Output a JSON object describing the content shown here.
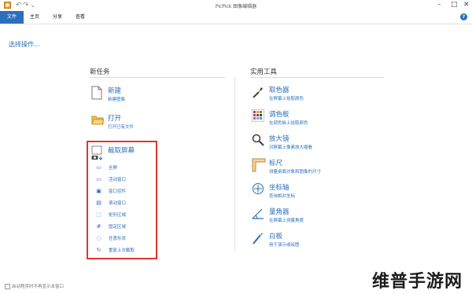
{
  "app": {
    "title": "PicPick 图像编辑器"
  },
  "menu": {
    "items": [
      "文件",
      "主页",
      "分享",
      "查看"
    ],
    "active": 0,
    "help": "?"
  },
  "window_controls": {
    "minimize": "–",
    "maximize": "□",
    "close": "✕"
  },
  "select_action": "选择操作...",
  "new_task": {
    "title": "新任务",
    "new": {
      "label": "新建",
      "sub": "新建图像"
    },
    "open": {
      "label": "打开",
      "sub": "打开已有文件"
    },
    "capture": {
      "label": "截取屏幕",
      "items": [
        "全屏",
        "活动窗口",
        "窗口控件",
        "滚动窗口",
        "矩形区域",
        "固定区域",
        "任意形状",
        "重复上次截取"
      ]
    }
  },
  "tools": {
    "title": "实用工具",
    "items": [
      {
        "label": "取色器",
        "sub": "在屏幕上拾取颜色"
      },
      {
        "label": "调色板",
        "sub": "在调色板上拾取颜色"
      },
      {
        "label": "放大镜",
        "sub": "对屏幕上像素放大缩看"
      },
      {
        "label": "标尺",
        "sub": "测量桌面对象和图像的尺寸"
      },
      {
        "label": "坐标轴",
        "sub": "查询相对坐标"
      },
      {
        "label": "量角器",
        "sub": "在屏幕上测量角度"
      },
      {
        "label": "白板",
        "sub": "用于演示或绘图"
      }
    ]
  },
  "startup_option": "启动程序时不再显示本窗口",
  "watermark": "维普手游网",
  "colors": {
    "accent": "#2b6fbd",
    "highlight_box": "#e03535"
  }
}
